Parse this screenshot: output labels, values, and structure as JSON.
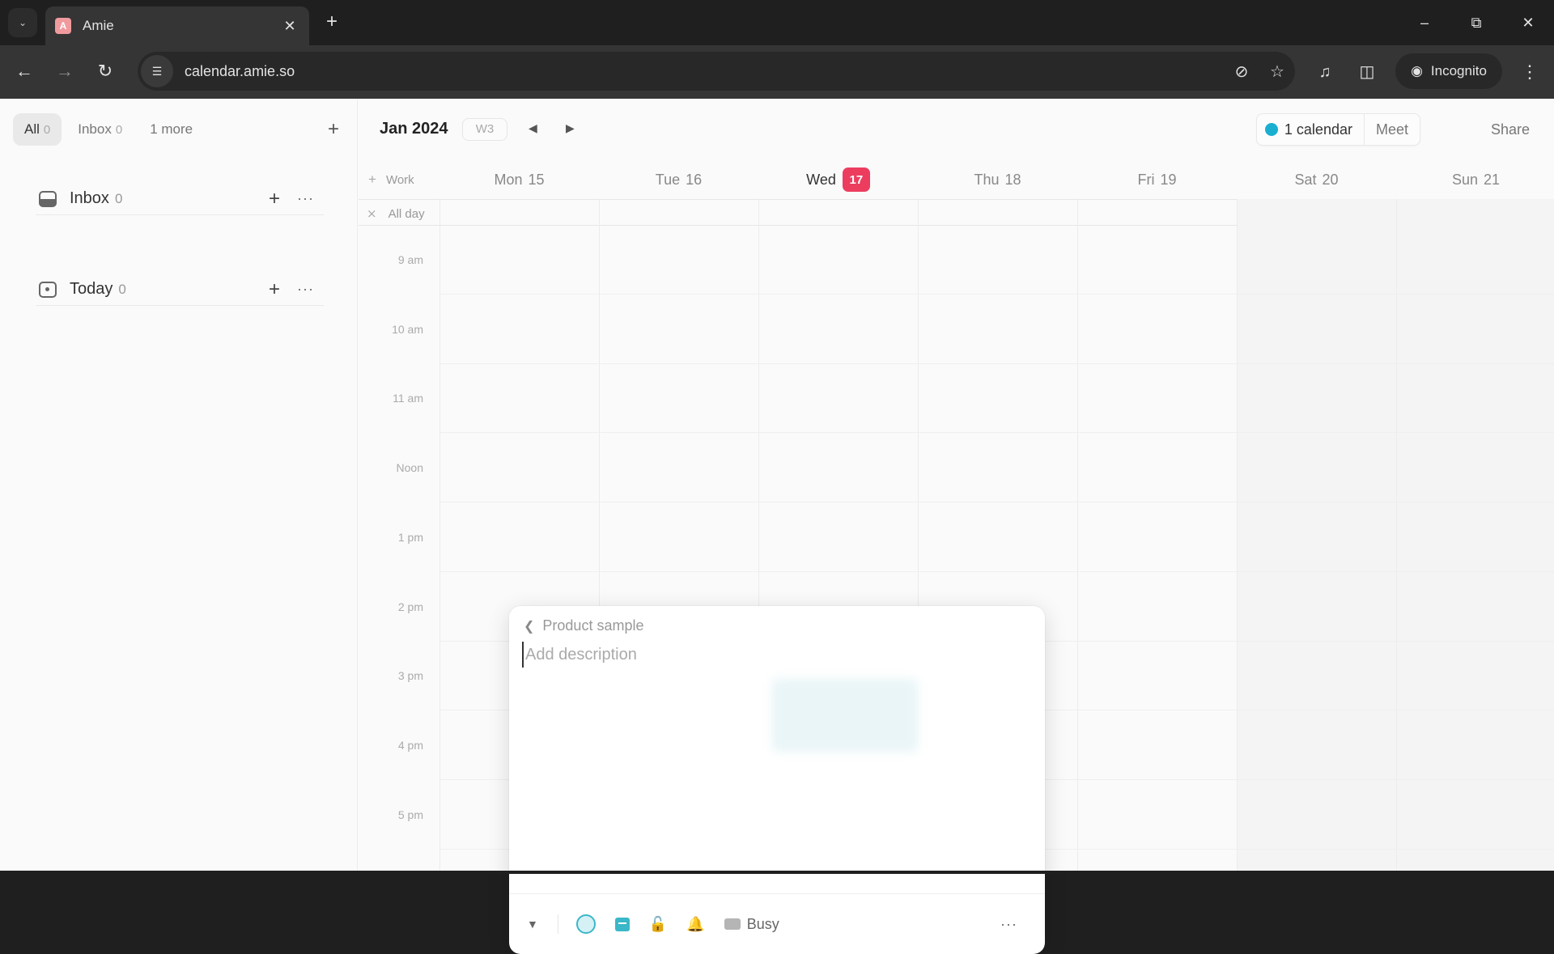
{
  "browser": {
    "tab_title": "Amie",
    "tab_favicon_letter": "A",
    "url": "calendar.amie.so",
    "incognito_label": "Incognito",
    "icons": {
      "tab_list": "chevron-down-icon",
      "close_tab": "close-icon",
      "new_tab": "plus-icon",
      "back": "arrow-left-icon",
      "forward": "arrow-right-icon",
      "reload": "reload-icon",
      "site_info": "tune-icon",
      "tracking": "eye-off-icon",
      "bookmark": "star-icon",
      "media": "media-queue-icon",
      "side_panel": "side-panel-icon",
      "menu": "kebab-icon"
    }
  },
  "sidebar": {
    "filters": [
      {
        "label": "All",
        "count": "0",
        "active": true
      },
      {
        "label": "Inbox",
        "count": "0",
        "active": false
      },
      {
        "label": "1 more",
        "count": "",
        "active": false
      }
    ],
    "sections": [
      {
        "label": "Inbox",
        "count": "0",
        "icon": "inbox-icon"
      },
      {
        "label": "Today",
        "count": "0",
        "icon": "calendar-today-icon"
      }
    ]
  },
  "calendar": {
    "month": "Jan 2024",
    "week": "W3",
    "calendars_label": "1 calendar",
    "calendar_color": "#1aafd0",
    "meet_label": "Meet",
    "share_label": "Share",
    "work_label": "Work",
    "all_day_label": "All day",
    "today_color": "#ec3d5f",
    "days": [
      {
        "name": "Mon",
        "date": "15",
        "today": false,
        "weekend": false
      },
      {
        "name": "Tue",
        "date": "16",
        "today": false,
        "weekend": false
      },
      {
        "name": "Wed",
        "date": "17",
        "today": true,
        "weekend": false
      },
      {
        "name": "Thu",
        "date": "18",
        "today": false,
        "weekend": false
      },
      {
        "name": "Fri",
        "date": "19",
        "today": false,
        "weekend": false
      },
      {
        "name": "Sat",
        "date": "20",
        "today": false,
        "weekend": true
      },
      {
        "name": "Sun",
        "date": "21",
        "today": false,
        "weekend": true
      }
    ],
    "hours": [
      "9 am",
      "10 am",
      "11 am",
      "Noon",
      "1 pm",
      "2 pm",
      "3 pm",
      "4 pm",
      "5 pm"
    ]
  },
  "popover": {
    "breadcrumb": "Product sample",
    "description_value": "",
    "description_placeholder": "Add description",
    "footer": {
      "availability": "Busy",
      "icons": [
        "caret-down-icon",
        "color-ring-icon",
        "calendar-icon",
        "unlock-icon",
        "bell-icon",
        "busy-swatch-icon",
        "more-icon"
      ]
    }
  }
}
